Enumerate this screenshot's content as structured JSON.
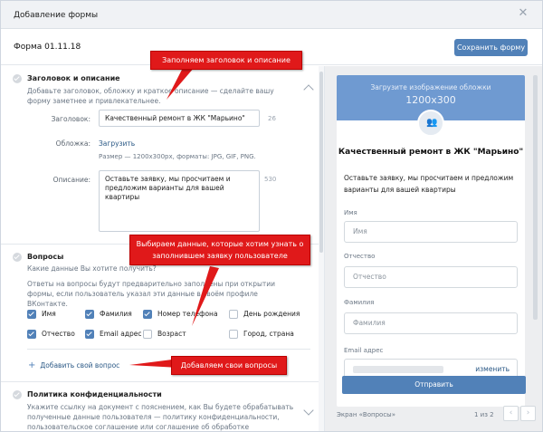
{
  "dialog": {
    "title": "Добавление формы",
    "close_glyph": "✕"
  },
  "toolbar": {
    "form_name": "Форма 01.11.18",
    "save_label": "Сохранить форму"
  },
  "editor": {
    "header_section": {
      "title": "Заголовок и описание",
      "description": "Добавьте заголовок, обложку и краткое описание — сделайте вашу форму заметнее и привлекательнее.",
      "title_label": "Заголовок:",
      "title_value": "Качественный ремонт в ЖК \"Марьино\"",
      "title_count": "26",
      "cover_label": "Обложка:",
      "cover_link": "Загрузить",
      "cover_hint": "Размер — 1200x300px, форматы: JPG, GIF, PNG.",
      "desc_label": "Описание:",
      "desc_value": "Оставьте заявку, мы просчитаем и предложим варианты для вашей квартиры",
      "desc_count": "530"
    },
    "questions_section": {
      "title": "Вопросы",
      "subtitle": "Какие данные Вы хотите получить?",
      "description": "Ответы на вопросы будут предварительно заполнены при открытии формы, если пользователь указал эти данные в своём профиле ВКонтакте.",
      "options": [
        {
          "label": "Имя",
          "checked": true
        },
        {
          "label": "Фамилия",
          "checked": true
        },
        {
          "label": "Номер телефона",
          "checked": true
        },
        {
          "label": "День рождения",
          "checked": false
        },
        {
          "label": "Отчество",
          "checked": true
        },
        {
          "label": "Email адрес",
          "checked": true
        },
        {
          "label": "Возраст",
          "checked": false
        },
        {
          "label": "Город, страна",
          "checked": false
        }
      ],
      "add_question": "Добавить свой вопрос"
    },
    "privacy_section": {
      "title": "Политика конфиденциальности",
      "description": "Укажите ссылку на документ с пояснением, как Вы будете обрабатывать полученные данные пользователя — политику конфиденциальности, пользовательское соглашение или соглашение об обработке персональных"
    }
  },
  "preview": {
    "cover_upload_text": "Загрузите изображение обложки",
    "cover_size_text": "1200x300",
    "title": "Качественный ремонт в ЖК \"Марьино\"",
    "description": "Оставьте заявку, мы просчитаем и предложим варианты для вашей квартиры",
    "fields": [
      {
        "label": "Имя",
        "placeholder": "Имя"
      },
      {
        "label": "Отчество",
        "placeholder": "Отчество"
      },
      {
        "label": "Фамилия",
        "placeholder": "Фамилия"
      },
      {
        "label": "Email адрес",
        "action": "изменить"
      }
    ],
    "submit_label": "Отправить",
    "screen_label": "Экран «Вопросы»",
    "page_label": "1 из 2",
    "prev_glyph": "‹",
    "next_glyph": "›"
  },
  "annotations": {
    "callout_title": "Заполняем заголовок и описание",
    "callout_data": "Выбираем данные, которые хотим узнать о заполнившем заявку пользователе",
    "callout_questions": "Добавляем свои вопросы",
    "color": "#e0191a"
  },
  "colors": {
    "accent": "#5181b8",
    "link": "#2a5885",
    "header_bg": "#f0f2f5",
    "preview_bg": "#edeef0"
  }
}
